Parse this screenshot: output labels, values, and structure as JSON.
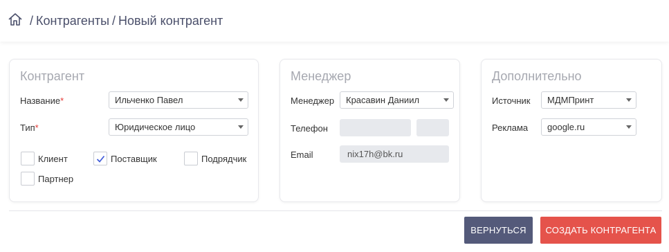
{
  "breadcrumb": {
    "home_icon": "home-icon",
    "separator": "/",
    "items": [
      "Контрагенты",
      "Новый контрагент"
    ]
  },
  "contractor": {
    "title": "Контрагент",
    "name_label": "Название",
    "name_value": "Ильченко Павел",
    "type_label": "Тип",
    "type_value": "Юридическое лицо",
    "required_mark": "*",
    "checkboxes": [
      {
        "label": "Клиент",
        "checked": false
      },
      {
        "label": "Поставщик",
        "checked": true
      },
      {
        "label": "Подрядчик",
        "checked": false
      },
      {
        "label": "Партнер",
        "checked": false
      }
    ]
  },
  "manager": {
    "title": "Менеджер",
    "manager_label": "Менеджер",
    "manager_value": "Красавин Даниил",
    "phone_label": "Телефон",
    "phone_value": "",
    "phone_ext_value": "",
    "email_label": "Email",
    "email_value": "nix17h@bk.ru"
  },
  "additional": {
    "title": "Дополнительно",
    "source_label": "Источник",
    "source_value": "МДМПринт",
    "ad_label": "Реклама",
    "ad_value": "google.ru"
  },
  "actions": {
    "back_label": "ВЕРНУТЬСЯ",
    "create_label": "СОЗДАТЬ КОНТРАГЕНТА"
  },
  "colors": {
    "back_button": "#545a7a",
    "create_button": "#e5534b",
    "check_mark": "#3f5bd9"
  }
}
